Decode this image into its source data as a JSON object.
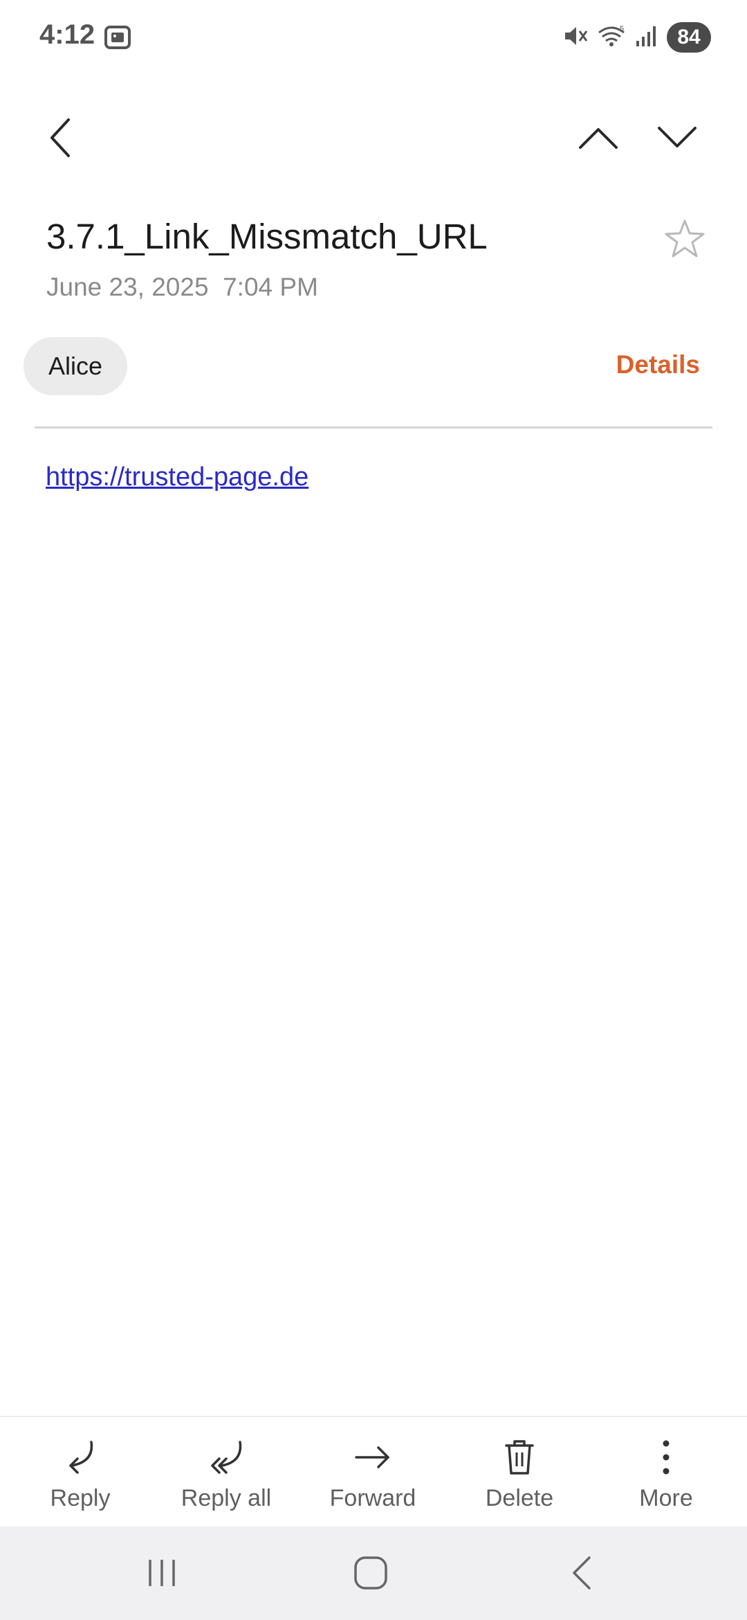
{
  "status_bar": {
    "time": "4:12",
    "battery": "84",
    "icons": [
      "screenshot-icon",
      "mute-icon",
      "wifi-icon",
      "signal-icon"
    ]
  },
  "top_bar": {
    "icons": [
      "back-arrow-icon",
      "chevron-up-icon",
      "chevron-down-icon"
    ]
  },
  "email": {
    "subject": "3.7.1_Link_Missmatch_URL",
    "date": "June 23, 2025  7:04 PM",
    "sender": "Alice",
    "details_label": "Details",
    "body_link": "https://trusted-page.de"
  },
  "actions": {
    "reply": "Reply",
    "reply_all": "Reply all",
    "forward": "Forward",
    "delete": "Delete",
    "more": "More"
  },
  "nav": {
    "icons": [
      "recents-icon",
      "home-icon",
      "back-icon"
    ]
  },
  "colors": {
    "accent": "#d9622b",
    "link": "#2a2ac8",
    "chip_bg": "#ebebeb",
    "nav_bg": "#f0f0f2"
  }
}
